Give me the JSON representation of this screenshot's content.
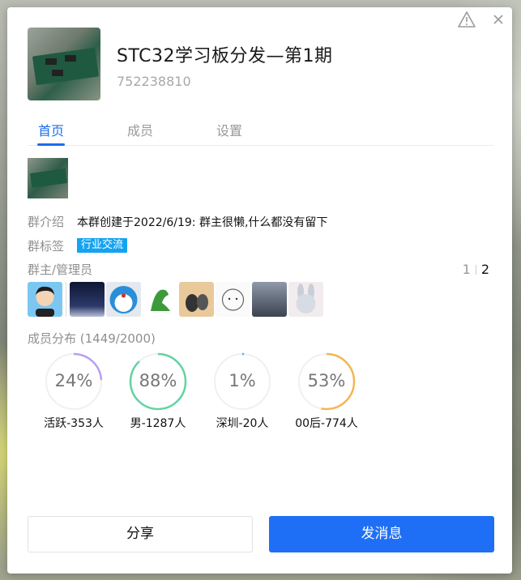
{
  "group": {
    "name": "STC32学习板分发—第1期",
    "id": "752238810"
  },
  "tabs": [
    {
      "label": "首页"
    },
    {
      "label": "成员"
    },
    {
      "label": "设置"
    }
  ],
  "intro": {
    "label": "群介绍",
    "text": "本群创建于2022/6/19:  群主很懒,什么都没有留下"
  },
  "tags": {
    "label": "群标签",
    "items": [
      "行业交流"
    ]
  },
  "admins": {
    "label": "群主/管理员",
    "page_prev": "1",
    "page_current": "2"
  },
  "distribution": {
    "label": "成员分布  (1449/2000)",
    "rings": [
      {
        "pct_label": "24%",
        "value": 0.24,
        "caption": "活跃-353人",
        "color": "#b79ef0"
      },
      {
        "pct_label": "88%",
        "value": 0.88,
        "caption": "男-1287人",
        "color": "#63d2a1"
      },
      {
        "pct_label": "1%",
        "value": 0.01,
        "caption": "深圳-20人",
        "color": "#5aa9ef"
      },
      {
        "pct_label": "53%",
        "value": 0.53,
        "caption": "00后-774人",
        "color": "#f5b551"
      }
    ]
  },
  "buttons": {
    "share": "分享",
    "send": "发消息"
  },
  "colors": {
    "accent": "#1c6dea",
    "primary_button": "#1f6ff6",
    "tag": "#14a3f0"
  }
}
